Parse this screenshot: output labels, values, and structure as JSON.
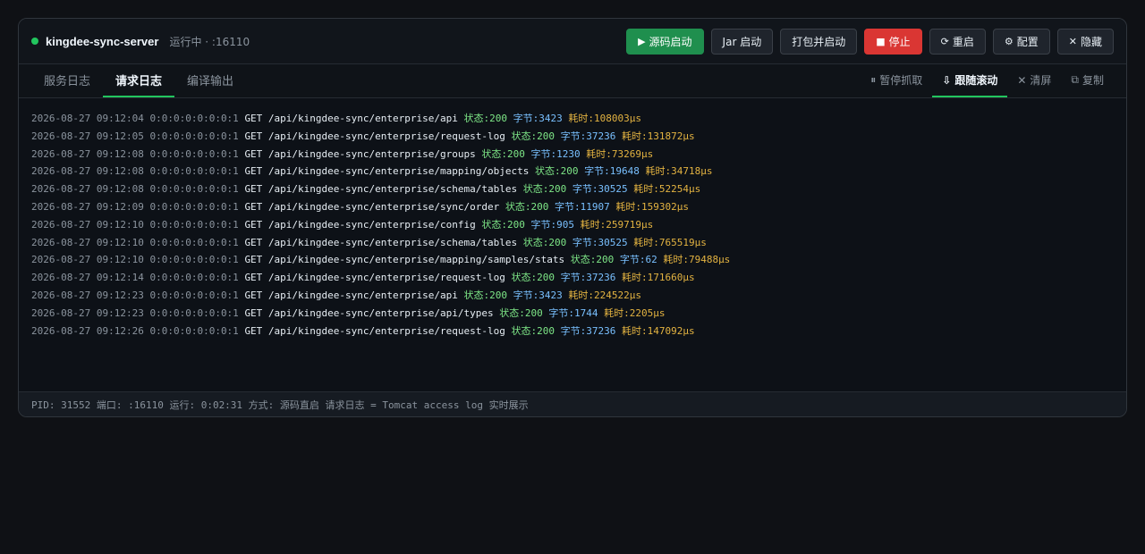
{
  "header": {
    "server_name": "kingdee-sync-server",
    "run_status": "运行中 · :16110",
    "buttons": {
      "source_start": "源码启动",
      "jar_start": "Jar 启动",
      "package_start": "打包并启动",
      "stop": "停止",
      "restart": "重启",
      "config": "配置",
      "hide": "隐藏"
    }
  },
  "tabs": [
    "服务日志",
    "请求日志",
    "编译输出"
  ],
  "tools": {
    "pause": "暂停抓取",
    "follow": "跟随滚动",
    "clear": "清屏",
    "copy": "复制"
  },
  "log_lines": [
    {
      "ts": "2026-08-27 09:12:04",
      "ip": "0:0:0:0:0:0:0:1",
      "method": "GET",
      "path": "/api/kingdee-sync/enterprise/api",
      "status": "状态:200",
      "bytes": "字节:3423",
      "time": "耗时:108003µs"
    },
    {
      "ts": "2026-08-27 09:12:05",
      "ip": "0:0:0:0:0:0:0:1",
      "method": "GET",
      "path": "/api/kingdee-sync/enterprise/request-log",
      "status": "状态:200",
      "bytes": "字节:37236",
      "time": "耗时:131872µs"
    },
    {
      "ts": "2026-08-27 09:12:08",
      "ip": "0:0:0:0:0:0:0:1",
      "method": "GET",
      "path": "/api/kingdee-sync/enterprise/groups",
      "status": "状态:200",
      "bytes": "字节:1230",
      "time": "耗时:73269µs"
    },
    {
      "ts": "2026-08-27 09:12:08",
      "ip": "0:0:0:0:0:0:0:1",
      "method": "GET",
      "path": "/api/kingdee-sync/enterprise/mapping/objects",
      "status": "状态:200",
      "bytes": "字节:19648",
      "time": "耗时:34718µs"
    },
    {
      "ts": "2026-08-27 09:12:08",
      "ip": "0:0:0:0:0:0:0:1",
      "method": "GET",
      "path": "/api/kingdee-sync/enterprise/schema/tables",
      "status": "状态:200",
      "bytes": "字节:30525",
      "time": "耗时:52254µs"
    },
    {
      "ts": "2026-08-27 09:12:09",
      "ip": "0:0:0:0:0:0:0:1",
      "method": "GET",
      "path": "/api/kingdee-sync/enterprise/sync/order",
      "status": "状态:200",
      "bytes": "字节:11907",
      "time": "耗时:159302µs"
    },
    {
      "ts": "2026-08-27 09:12:10",
      "ip": "0:0:0:0:0:0:0:1",
      "method": "GET",
      "path": "/api/kingdee-sync/enterprise/config",
      "status": "状态:200",
      "bytes": "字节:905",
      "time": "耗时:259719µs"
    },
    {
      "ts": "2026-08-27 09:12:10",
      "ip": "0:0:0:0:0:0:0:1",
      "method": "GET",
      "path": "/api/kingdee-sync/enterprise/schema/tables",
      "status": "状态:200",
      "bytes": "字节:30525",
      "time": "耗时:765519µs"
    },
    {
      "ts": "2026-08-27 09:12:10",
      "ip": "0:0:0:0:0:0:0:1",
      "method": "GET",
      "path": "/api/kingdee-sync/enterprise/mapping/samples/stats",
      "status": "状态:200",
      "bytes": "字节:62",
      "time": "耗时:79488µs"
    },
    {
      "ts": "2026-08-27 09:12:14",
      "ip": "0:0:0:0:0:0:0:1",
      "method": "GET",
      "path": "/api/kingdee-sync/enterprise/request-log",
      "status": "状态:200",
      "bytes": "字节:37236",
      "time": "耗时:171660µs"
    },
    {
      "ts": "2026-08-27 09:12:23",
      "ip": "0:0:0:0:0:0:0:1",
      "method": "GET",
      "path": "/api/kingdee-sync/enterprise/api",
      "status": "状态:200",
      "bytes": "字节:3423",
      "time": "耗时:224522µs"
    },
    {
      "ts": "2026-08-27 09:12:23",
      "ip": "0:0:0:0:0:0:0:1",
      "method": "GET",
      "path": "/api/kingdee-sync/enterprise/api/types",
      "status": "状态:200",
      "bytes": "字节:1744",
      "time": "耗时:2205µs"
    },
    {
      "ts": "2026-08-27 09:12:26",
      "ip": "0:0:0:0:0:0:0:1",
      "method": "GET",
      "path": "/api/kingdee-sync/enterprise/request-log",
      "status": "状态:200",
      "bytes": "字节:37236",
      "time": "耗时:147092µs"
    }
  ],
  "footer": {
    "text": "PID: 31552 端口: :16110 运行: 0:02:31 方式: 源码直启 请求日志 = Tomcat access log 实时展示"
  },
  "colors": {
    "status_dot": "#22c55e",
    "primary_button": "#1f8f4e",
    "danger_button": "#da3633",
    "active_underline": "#22c55e",
    "status_text": "#7ee787",
    "bytes_text": "#79c0ff",
    "time_text": "#e3b341"
  },
  "icons": {
    "source_start": "play-icon",
    "stop": "square-icon",
    "restart": "refresh-icon",
    "config": "gear-icon",
    "hide": "close-icon",
    "pause": "pause-icon",
    "follow": "arrow-down-icon",
    "clear": "x-icon",
    "copy": "copy-icon"
  }
}
